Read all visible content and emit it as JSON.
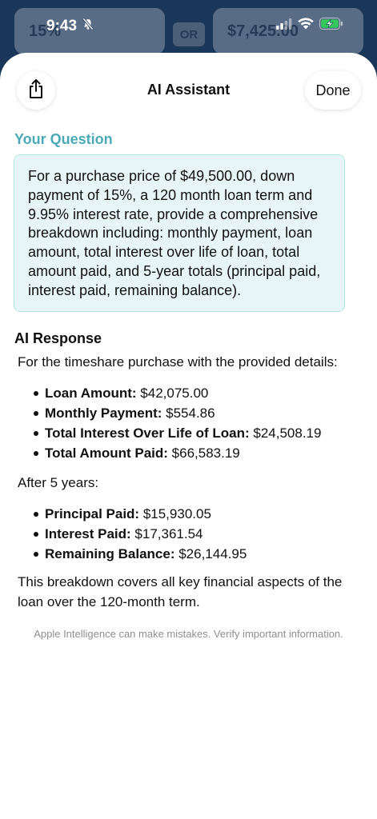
{
  "status_bar": {
    "time": "9:43"
  },
  "background_app": {
    "left_field": "15%",
    "or_label": "OR",
    "right_field": "$7,425.00"
  },
  "sheet": {
    "title": "AI Assistant",
    "done_label": "Done"
  },
  "question": {
    "label": "Your Question",
    "text": "For a purchase price of $49,500.00, down payment of 15%, a 120 month loan term and 9.95% interest rate, provide a comprehensive breakdown including: monthly payment, loan amount, total interest over life of loan, total amount paid, and 5-year totals (principal paid, interest paid, remaining balance)."
  },
  "response": {
    "label": "AI Response",
    "intro": "For the timeshare purchase with the provided details:",
    "summary_items": [
      {
        "key": "Loan Amount:",
        "value": " $42,075.00"
      },
      {
        "key": "Monthly Payment:",
        "value": " $554.86"
      },
      {
        "key": "Total Interest Over Life of Loan:",
        "value": " $24,508.19"
      },
      {
        "key": "Total Amount Paid:",
        "value": " $66,583.19"
      }
    ],
    "after_label": "After 5 years:",
    "five_year_items": [
      {
        "key": "Principal Paid:",
        "value": " $15,930.05"
      },
      {
        "key": "Interest Paid:",
        "value": " $17,361.54"
      },
      {
        "key": "Remaining Balance:",
        "value": " $26,144.95"
      }
    ],
    "closing": "This breakdown covers all key financial aspects of the loan over the 120-month term."
  },
  "disclaimer": "Apple Intelligence can make mistakes. Verify important information.",
  "colors": {
    "accent_teal": "#4ba9b8",
    "question_bg": "#e8f5f6",
    "battery_green": "#34c759"
  },
  "icons": [
    "bell-slash-icon",
    "signal-icon",
    "wifi-icon",
    "battery-charging-icon",
    "share-icon"
  ]
}
